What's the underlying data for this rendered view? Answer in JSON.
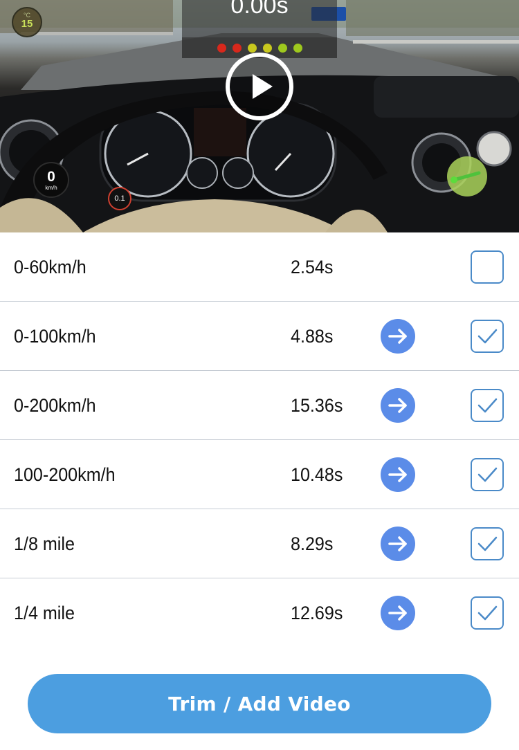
{
  "video": {
    "temperature": {
      "unit": "°C",
      "value": "15"
    },
    "timer": "0.00s",
    "start_lights": [
      "#d8281c",
      "#d8281c",
      "#c8c81e",
      "#c8c81e",
      "#9ec81e",
      "#9ec81e"
    ],
    "speed": {
      "value": "0",
      "unit": "km/h"
    },
    "g_force": {
      "value": "0.1"
    }
  },
  "results": [
    {
      "label": "0-60km/h",
      "time": "2.54s",
      "has_arrow": false,
      "checked": false
    },
    {
      "label": "0-100km/h",
      "time": "4.88s",
      "has_arrow": true,
      "checked": true
    },
    {
      "label": "0-200km/h",
      "time": "15.36s",
      "has_arrow": true,
      "checked": true
    },
    {
      "label": "100-200km/h",
      "time": "10.48s",
      "has_arrow": true,
      "checked": true
    },
    {
      "label": "1/8 mile",
      "time": "8.29s",
      "has_arrow": true,
      "checked": true
    },
    {
      "label": "1/4 mile",
      "time": "12.69s",
      "has_arrow": true,
      "checked": true
    }
  ],
  "actions": {
    "trim_label": "Trim / Add Video"
  },
  "colors": {
    "accent": "#4c9ee0",
    "arrow": "#5b8ce8",
    "checkbox": "#4a8ac8",
    "divider": "#c6ccd4"
  }
}
